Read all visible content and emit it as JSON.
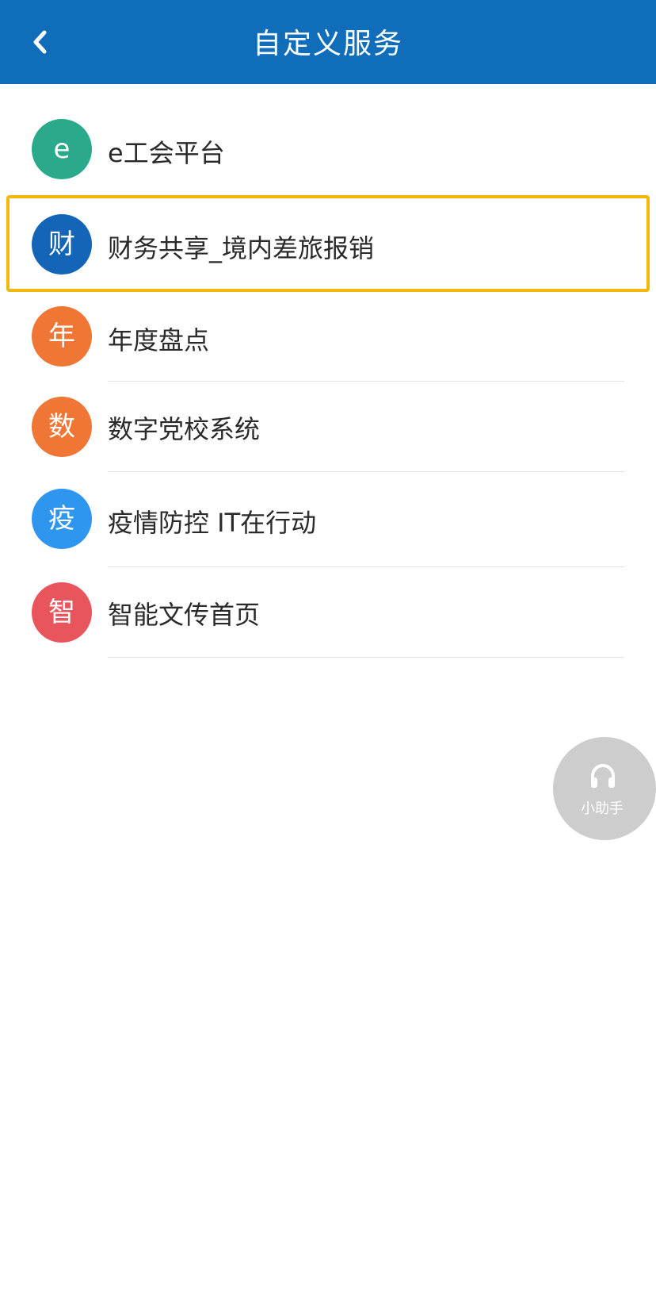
{
  "header": {
    "title": "自定义服务",
    "back_icon": "chevron-left-icon",
    "background_color": "#106dba"
  },
  "services": [
    {
      "avatar_text": "e",
      "label": "e工会平台",
      "color": "#2aaa8a"
    },
    {
      "avatar_text": "财",
      "label": "财务共享_境内差旅报销",
      "color": "#1465b8",
      "highlighted": true
    },
    {
      "avatar_text": "年",
      "label": "年度盘点",
      "color": "#f07636"
    },
    {
      "avatar_text": "数",
      "label": "数字党校系统",
      "color": "#f07636"
    },
    {
      "avatar_text": "疫",
      "label": "疫情防控 IT在行动",
      "color": "#2f96ef"
    },
    {
      "avatar_text": "智",
      "label": "智能文传首页",
      "color": "#e9555c"
    }
  ],
  "highlight_color": "#f5b70c",
  "assistant": {
    "label": "小助手",
    "icon": "headset-icon",
    "color": "#cdcdcd"
  }
}
